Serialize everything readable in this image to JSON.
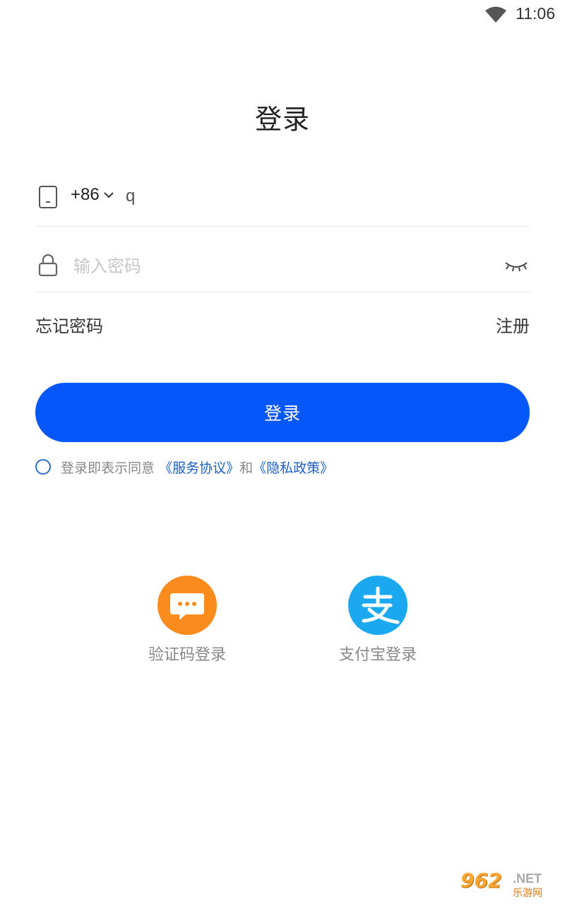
{
  "status_bar": {
    "time": "11:06",
    "wifi_icon": "wifi-icon"
  },
  "title": "登录",
  "phone": {
    "country_code": "+86",
    "value": "q",
    "icon": "phone-icon"
  },
  "password": {
    "placeholder": "输入密码",
    "icon": "lock-icon",
    "toggle_icon": "eye-closed-icon"
  },
  "links": {
    "forgot": "忘记密码",
    "register": "注册"
  },
  "login_button": "登录",
  "agreement": {
    "prefix": "登录即表示同意",
    "service": "《服务协议》",
    "and": "和",
    "privacy": "《隐私政策》"
  },
  "alt_logins": [
    {
      "label": "验证码登录",
      "icon": "sms-icon",
      "color": "#fa8c1e"
    },
    {
      "label": "支付宝登录",
      "icon": "alipay-icon",
      "color": "#1aa8f0"
    }
  ],
  "watermark": {
    "number": "962",
    "suffix": ".NET",
    "cn": "乐游网"
  },
  "colors": {
    "primary": "#0557fa",
    "link": "#1a5fc8"
  }
}
